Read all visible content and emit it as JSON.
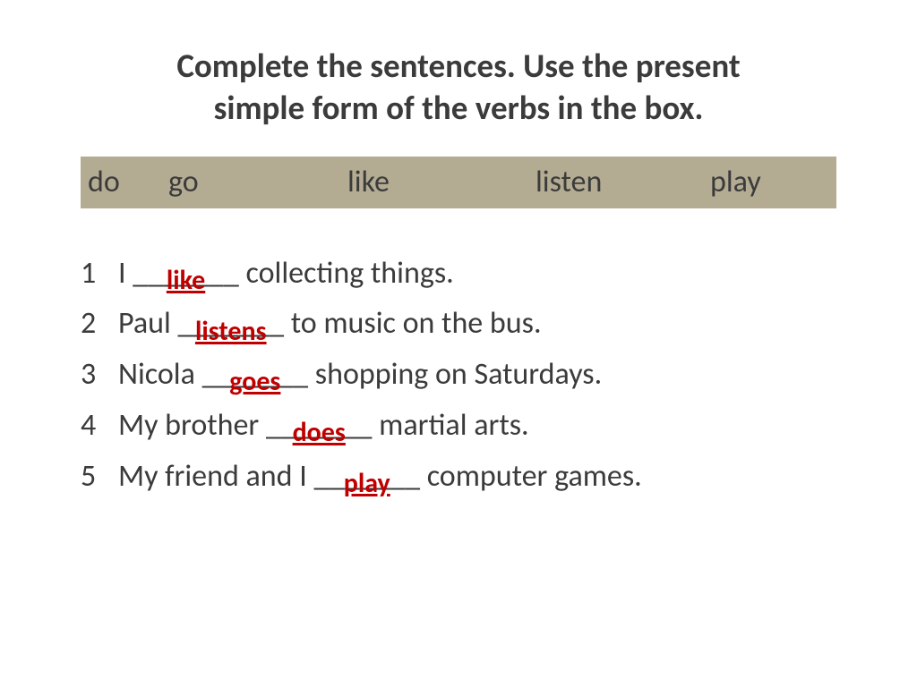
{
  "title_line1": "Complete the sentences. Use the present",
  "title_line2": "simple form of  the verbs in the box.",
  "verbs": {
    "v1": "do",
    "v2": "go",
    "v3": "like",
    "v4": "listen",
    "v5": "play"
  },
  "items": [
    {
      "n": "1",
      "pre": "I ",
      "blank": "_______",
      "answer": "like",
      "post": " collecting things."
    },
    {
      "n": "2",
      "pre": "Paul ",
      "blank": "_______",
      "answer": "listens",
      "post": " to music on the bus."
    },
    {
      "n": "3",
      "pre": "Nicola ",
      "blank": "_______",
      "answer": "goes",
      "post": " shopping on Saturdays."
    },
    {
      "n": "4",
      "pre": "My brother ",
      "blank": "_______",
      "answer": "does",
      "post": " martial arts."
    },
    {
      "n": "5",
      "pre": "My friend and I ",
      "blank": "_______",
      "answer": "play",
      "post": " computer games."
    }
  ]
}
